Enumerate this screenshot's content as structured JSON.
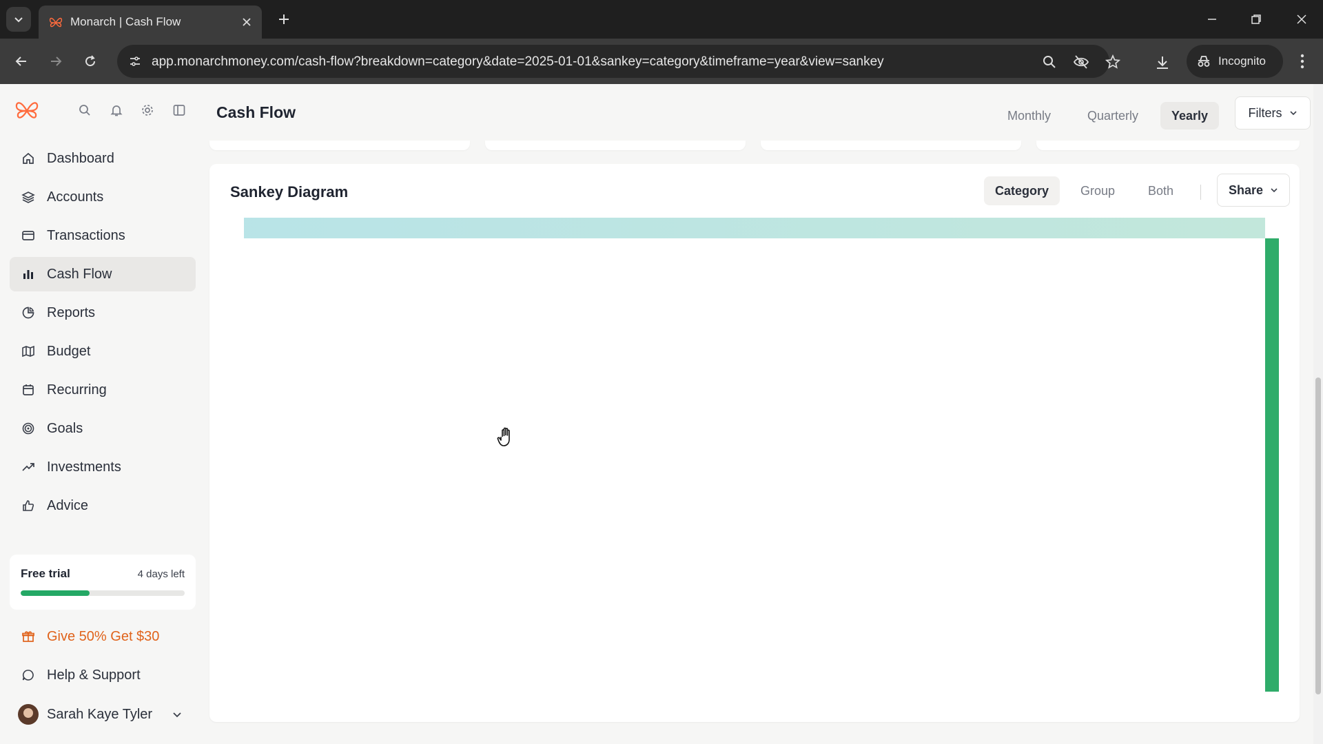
{
  "browser": {
    "tab_title": "Monarch | Cash Flow",
    "url": "app.monarchmoney.com/cash-flow?breakdown=category&date=2025-01-01&sankey=category&timeframe=year&view=sankey",
    "incognito_label": "Incognito"
  },
  "header": {
    "title": "Cash Flow",
    "periods": [
      "Monthly",
      "Quarterly",
      "Yearly"
    ],
    "active_period": "Yearly",
    "filters_label": "Filters"
  },
  "sidebar": {
    "items": [
      {
        "label": "Dashboard",
        "icon": "home-icon"
      },
      {
        "label": "Accounts",
        "icon": "layers-icon"
      },
      {
        "label": "Transactions",
        "icon": "credit-card-icon"
      },
      {
        "label": "Cash Flow",
        "icon": "bar-chart-icon"
      },
      {
        "label": "Reports",
        "icon": "pie-chart-icon"
      },
      {
        "label": "Budget",
        "icon": "map-icon"
      },
      {
        "label": "Recurring",
        "icon": "calendar-icon"
      },
      {
        "label": "Goals",
        "icon": "target-icon"
      },
      {
        "label": "Investments",
        "icon": "trending-up-icon"
      },
      {
        "label": "Advice",
        "icon": "thumbs-up-icon"
      }
    ],
    "active_item": "Cash Flow",
    "trial": {
      "title": "Free trial",
      "days_left": "4 days left",
      "progress": 0.42
    },
    "referral_label": "Give 50% Get $30",
    "help_label": "Help & Support",
    "user_name": "Sarah Kaye Tyler"
  },
  "sankey": {
    "title": "Sankey Diagram",
    "modes": [
      "Category",
      "Group",
      "Both"
    ],
    "active_mode": "Category",
    "share_label": "Share"
  },
  "colors": {
    "accent_green": "#2fac6a",
    "brand_orange": "#e0631b",
    "link_teal": "#b5e2e6"
  }
}
